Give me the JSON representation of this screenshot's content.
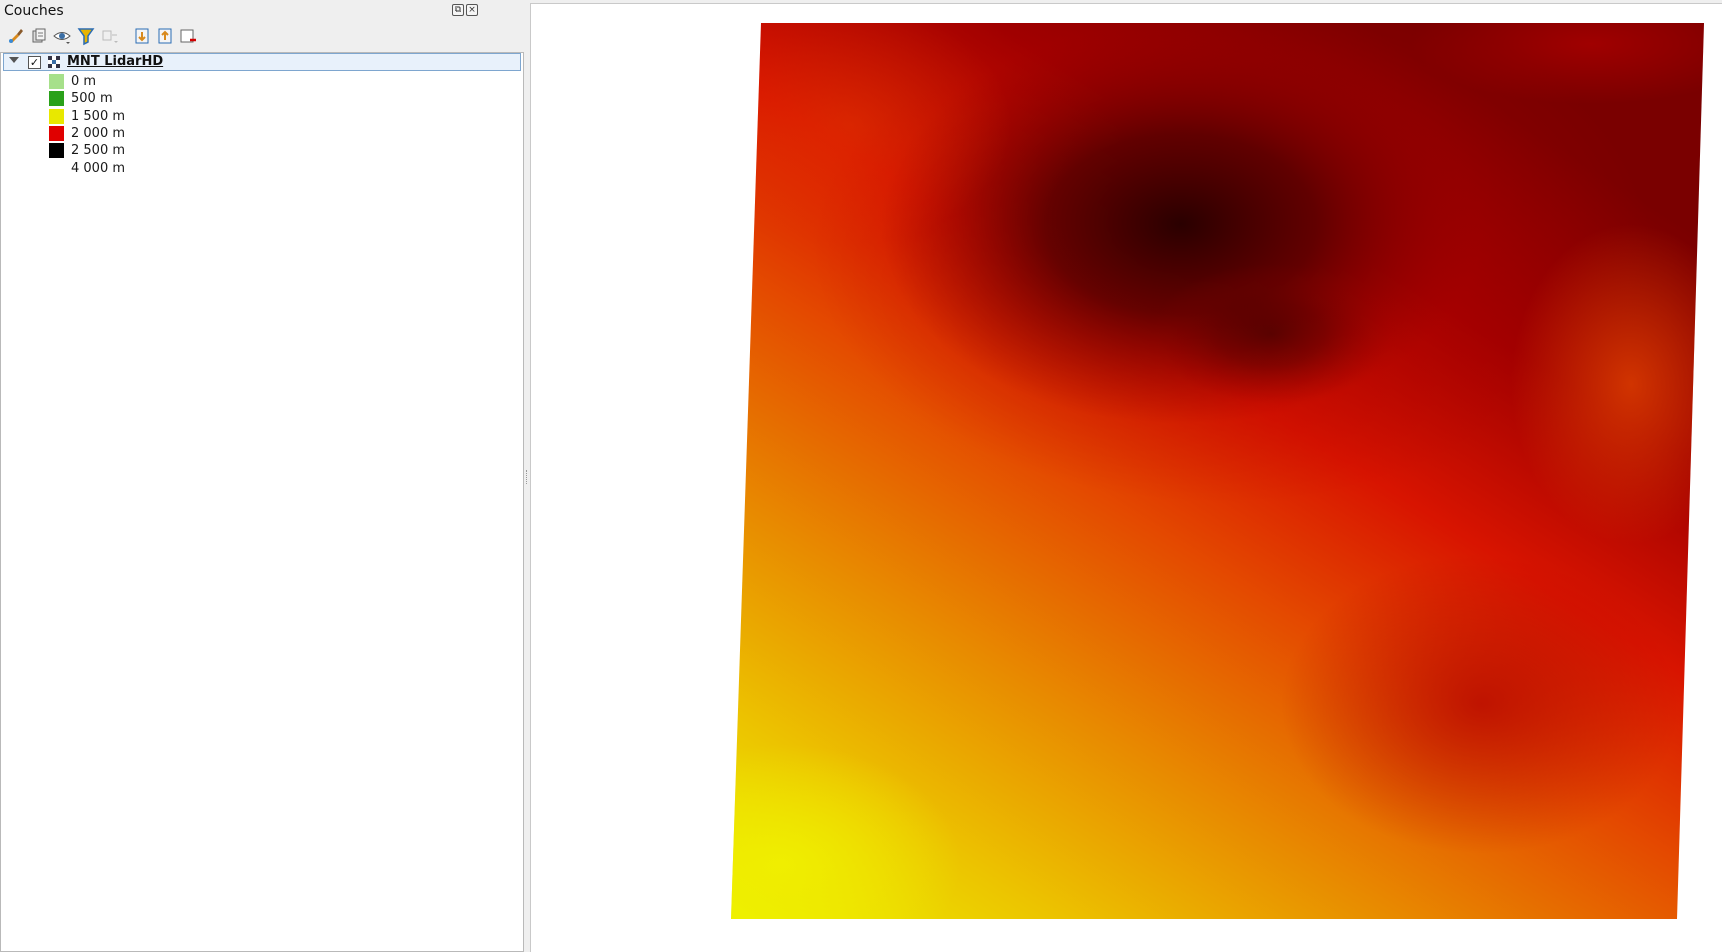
{
  "panel": {
    "title": "Couches"
  },
  "toolbar": {
    "icons": [
      "style-brush-icon",
      "add-group-icon",
      "visibility-eye-icon",
      "filter-legend-icon",
      "expression-filter-icon",
      "expand-all-icon",
      "collapse-all-icon",
      "remove-layer-icon"
    ]
  },
  "layer": {
    "name": "MNT LidarHD",
    "visible": true,
    "expanded": true,
    "legend": [
      {
        "label": "0 m",
        "color": "#a6e08a"
      },
      {
        "label": "500 m",
        "color": "#2aa11a"
      },
      {
        "label": "1 500 m",
        "color": "#e8e800"
      },
      {
        "label": "2 000 m",
        "color": "#e00000"
      },
      {
        "label": "2 500 m",
        "color": "#000000"
      },
      {
        "label": "4 000 m",
        "color": "#ffffff"
      }
    ]
  },
  "colors": {
    "selection_bg": "#e8f1fb",
    "selection_border": "#7ea6cf",
    "panel_bg": "#efefef"
  }
}
